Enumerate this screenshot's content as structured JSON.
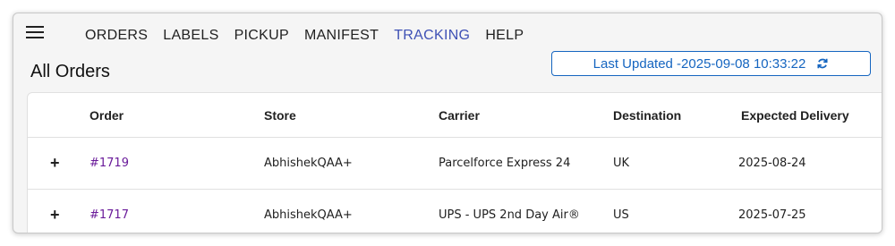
{
  "nav": {
    "items": [
      {
        "label": "ORDERS"
      },
      {
        "label": "LABELS"
      },
      {
        "label": "PICKUP"
      },
      {
        "label": "MANIFEST"
      },
      {
        "label": "TRACKING",
        "active": true
      },
      {
        "label": "HELP"
      }
    ]
  },
  "page": {
    "title": "All Orders",
    "last_updated": "Last Updated -2025-09-08 10:33:22",
    "refresh_icon": "refresh-icon"
  },
  "table": {
    "headers": {
      "order": "Order",
      "store": "Store",
      "carrier": "Carrier",
      "destination": "Destination",
      "expected_delivery": "Expected Delivery"
    },
    "rows": [
      {
        "expand": "+",
        "order": "#1719",
        "store": "AbhishekQAA+",
        "carrier": "Parcelforce Express 24",
        "destination": "UK",
        "expected_delivery": "2025-08-24"
      },
      {
        "expand": "+",
        "order": "#1717",
        "store": "AbhishekQAA+",
        "carrier": "UPS - UPS 2nd Day Air®",
        "destination": "US",
        "expected_delivery": "2025-07-25"
      }
    ]
  },
  "colors": {
    "active_nav": "#3f51b5",
    "link": "#6a1b9a",
    "button_blue": "#1565c0"
  }
}
